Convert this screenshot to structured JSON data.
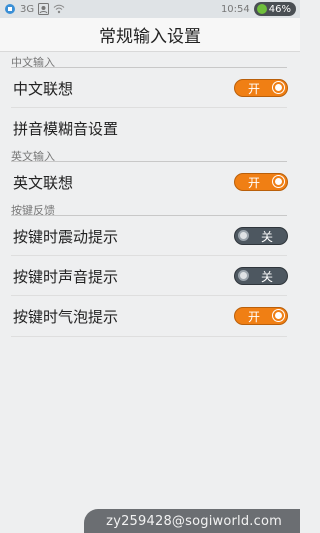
{
  "status_bar": {
    "network": "3G",
    "time": "10:54",
    "battery": "46%"
  },
  "header": {
    "title": "常规输入设置"
  },
  "sections": [
    {
      "title": "中文输入",
      "rows": [
        {
          "label": "中文联想",
          "toggle": {
            "state": "on",
            "text": "开"
          }
        },
        {
          "label": "拼音模糊音设置"
        }
      ]
    },
    {
      "title": "英文输入",
      "rows": [
        {
          "label": "英文联想",
          "toggle": {
            "state": "on",
            "text": "开"
          }
        }
      ]
    },
    {
      "title": "按键反馈",
      "rows": [
        {
          "label": "按键时震动提示",
          "toggle": {
            "state": "off",
            "text": "关"
          }
        },
        {
          "label": "按键时声音提示",
          "toggle": {
            "state": "off",
            "text": "关"
          }
        },
        {
          "label": "按键时气泡提示",
          "toggle": {
            "state": "on",
            "text": "开"
          }
        }
      ]
    }
  ],
  "watermark": "zy259428@sogiworld.com",
  "colors": {
    "toggle_on": "#f07f14",
    "toggle_off": "#4d5760",
    "background": "#eeeff0"
  }
}
